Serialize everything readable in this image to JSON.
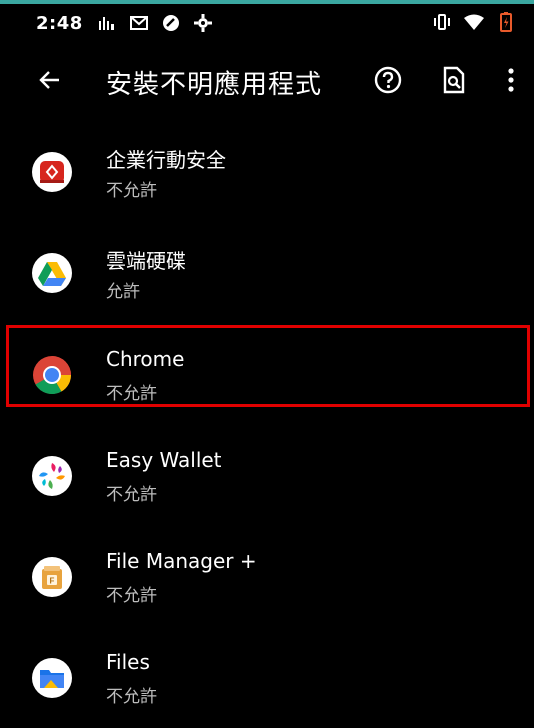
{
  "statusbar": {
    "time": "2:48",
    "left_icons": [
      "signal-bars-icon",
      "gmail-icon",
      "app-circle-icon",
      "gear-icon"
    ],
    "right_icons": [
      "vibrate-icon",
      "wifi-icon",
      "battery-icon"
    ]
  },
  "appbar": {
    "title": "安裝不明應用程式"
  },
  "apps": [
    {
      "name": "企業行動安全",
      "status": "不允許",
      "icon": "enterprise-security-icon"
    },
    {
      "name": "雲端硬碟",
      "status": "允許",
      "icon": "google-drive-icon"
    },
    {
      "name": "Chrome",
      "status": "不允許",
      "icon": "chrome-icon"
    },
    {
      "name": "Easy Wallet",
      "status": "不允許",
      "icon": "easy-wallet-icon"
    },
    {
      "name": "File Manager +",
      "status": "不允許",
      "icon": "file-manager-icon"
    },
    {
      "name": "Files",
      "status": "不允許",
      "icon": "files-icon"
    }
  ],
  "colors": {
    "background": "#000000",
    "highlight": "#e00000",
    "accent": "#3aa7a0"
  }
}
